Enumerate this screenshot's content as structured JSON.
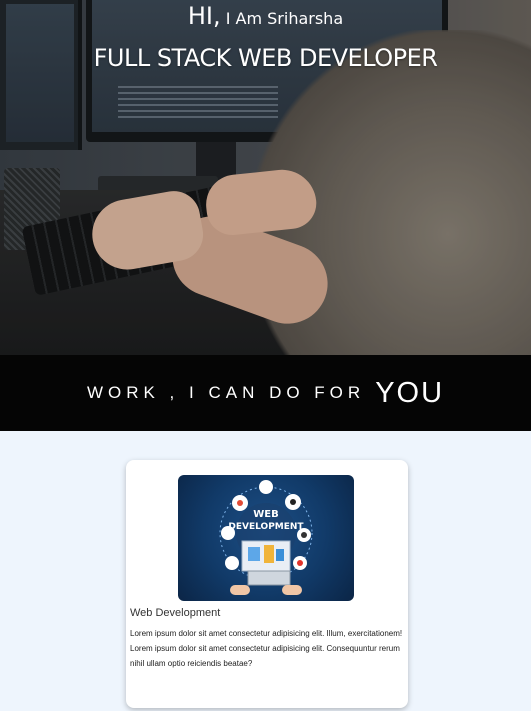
{
  "hero": {
    "greeting_hi": "HI,",
    "greeting_name": "I Am Sriharsha",
    "title": "FULL STACK WEB DEVELOPER"
  },
  "banner": {
    "small_text": "WORK , I CAN DO FOR",
    "big_text": "YOU"
  },
  "services": [
    {
      "image_text_line1": "WEB",
      "image_text_line2": "DEVELOPMENT",
      "title": "Web Development",
      "desc_line1": "Lorem ipsum dolor sit amet consectetur adipisicing elit. Illum, exercitationem!",
      "desc_line2": "Lorem ipsum dolor sit amet consectetur adipisicing elit. Consequuntur rerum nihil ullam optio reiciendis beatae?"
    }
  ],
  "colors": {
    "banner_bg": "#050505",
    "page_bg": "#eef5fd",
    "card_bg": "#ffffff"
  }
}
